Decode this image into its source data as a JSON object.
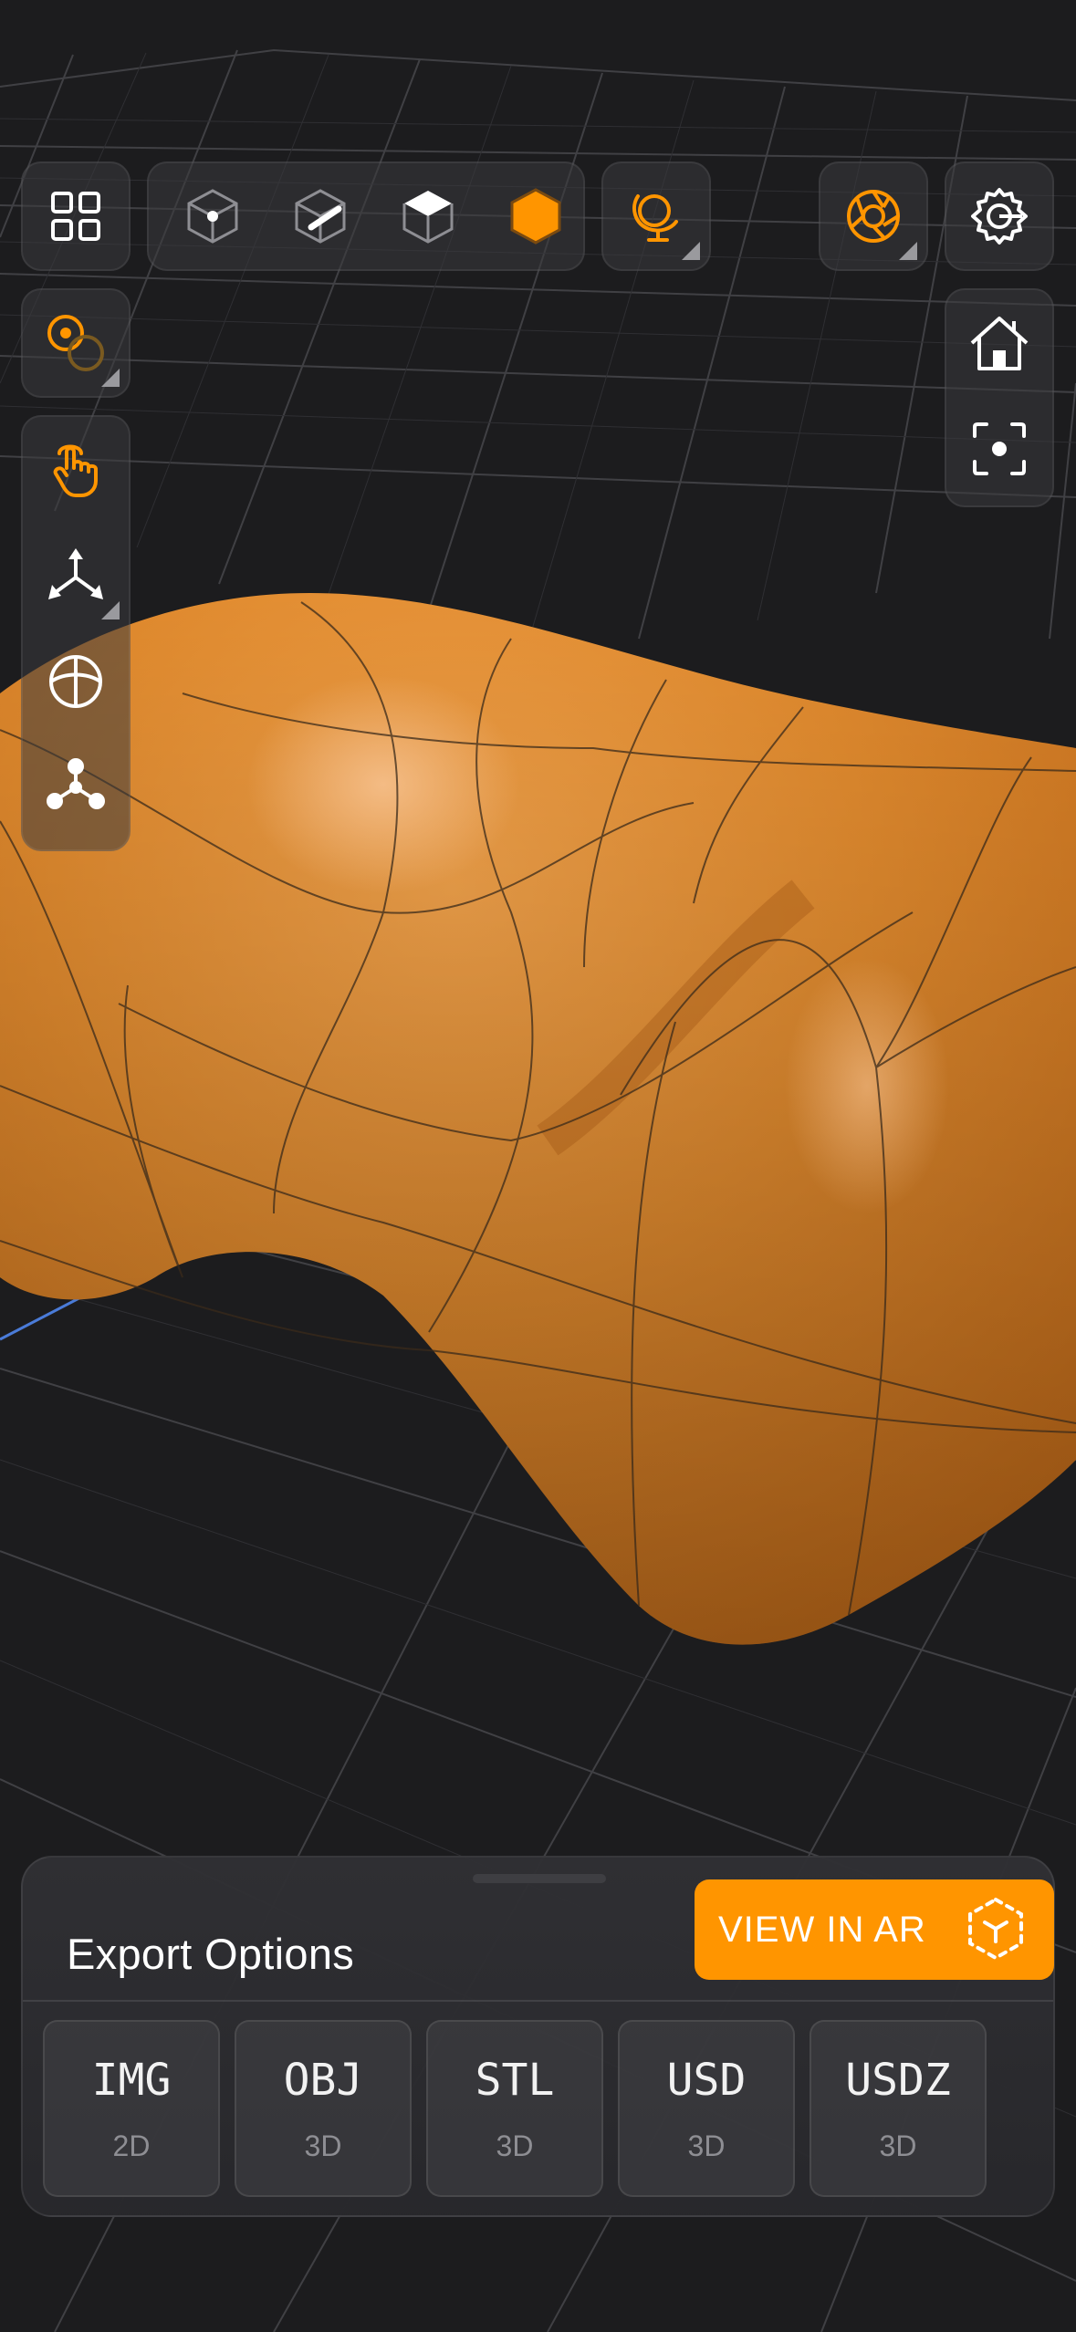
{
  "toolbar": {
    "top": [
      {
        "name": "grid-menu-icon"
      },
      {
        "name": "vertex-mode-icon"
      },
      {
        "name": "edge-mode-icon"
      },
      {
        "name": "face-mode-icon"
      },
      {
        "name": "object-mode-icon",
        "active": true
      },
      {
        "name": "environment-globe-icon"
      },
      {
        "name": "camera-aperture-icon"
      },
      {
        "name": "settings-gear-icon"
      }
    ],
    "left": [
      {
        "name": "pivot-origin-icon"
      },
      {
        "name": "touch-select-icon"
      },
      {
        "name": "move-gizmo-icon"
      },
      {
        "name": "rotate-sphere-icon"
      },
      {
        "name": "scale-nodes-icon"
      }
    ],
    "right": [
      {
        "name": "home-view-icon"
      },
      {
        "name": "focus-frame-icon"
      }
    ]
  },
  "colors": {
    "accent": "#ff9500",
    "background": "#1c1c1e",
    "model": "#e08a2e"
  },
  "export": {
    "title": "Export Options",
    "ar_button": "VIEW IN AR",
    "formats": [
      {
        "name": "IMG",
        "sub": "2D"
      },
      {
        "name": "OBJ",
        "sub": "3D"
      },
      {
        "name": "STL",
        "sub": "3D"
      },
      {
        "name": "USD",
        "sub": "3D"
      },
      {
        "name": "USDZ",
        "sub": "3D"
      }
    ]
  }
}
